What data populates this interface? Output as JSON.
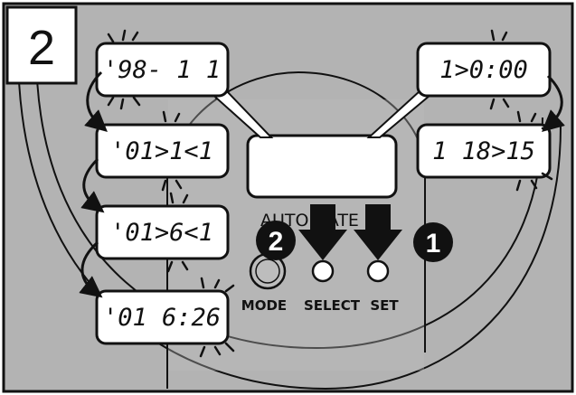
{
  "step_number": "2",
  "header_text": "AUTO DATE",
  "buttons": {
    "mode": "MODE",
    "select": "SELECT",
    "set": "SET"
  },
  "badges": {
    "first": "1",
    "second": "2"
  },
  "displays": {
    "left": [
      "'98- 1 1",
      "'01>1<1",
      "'01>6<1",
      "'01 6:26"
    ],
    "right": [
      "1>0:00",
      "1 18>15"
    ]
  },
  "colors": {
    "background": "#b3b3b3",
    "camera_body": "#bdbdbd",
    "lcd": "#ffffff",
    "ink": "#111111"
  }
}
